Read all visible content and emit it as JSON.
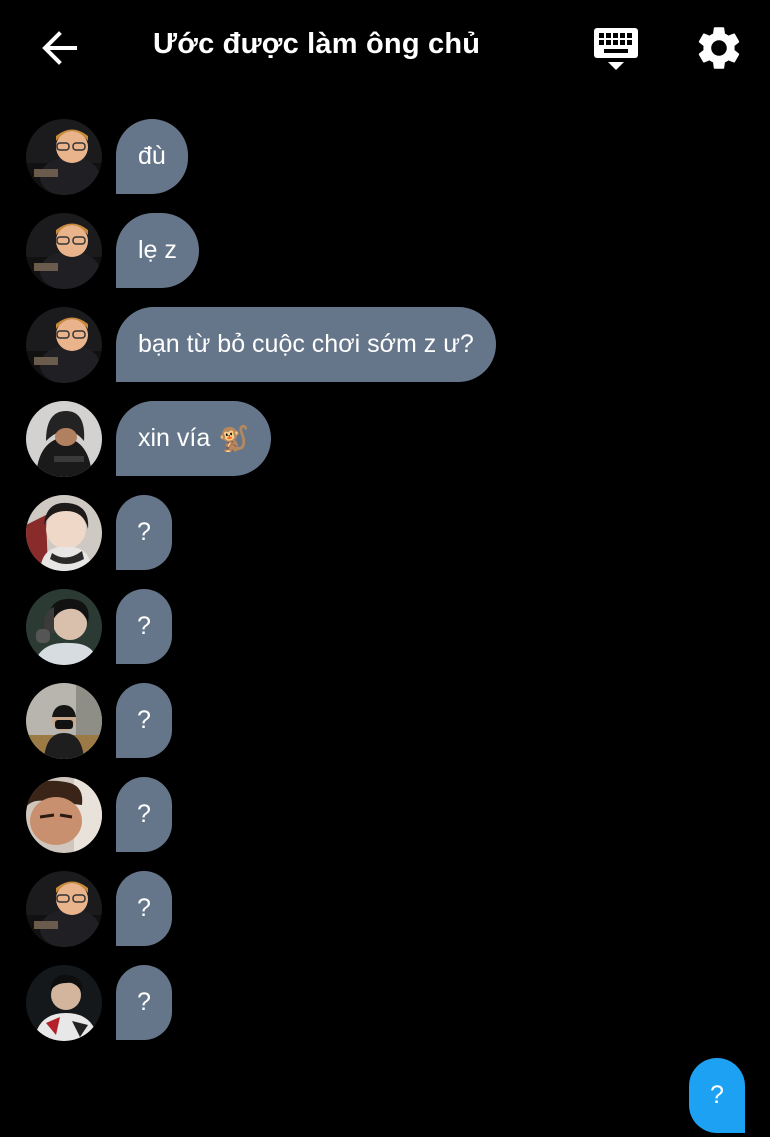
{
  "header": {
    "title": "Ước được làm ông chủ",
    "icons": {
      "back": "arrow-left-icon",
      "keyboard": "keyboard-icon",
      "settings": "gear-icon"
    }
  },
  "messages": [
    {
      "text": "đù",
      "avatar": "avatar-glasses-boy"
    },
    {
      "text": "lẹ z",
      "avatar": "avatar-glasses-boy"
    },
    {
      "text": "bạn từ bỏ cuộc chơi sớm z ư?",
      "avatar": "avatar-glasses-boy"
    },
    {
      "text": "xin vía",
      "emoji": "🐒",
      "avatar": "avatar-hooded"
    },
    {
      "text": "?",
      "avatar": "avatar-soft-face"
    },
    {
      "text": "?",
      "avatar": "avatar-headset"
    },
    {
      "text": "?",
      "avatar": "avatar-mask"
    },
    {
      "text": "?",
      "avatar": "avatar-closeup"
    },
    {
      "text": "?",
      "avatar": "avatar-glasses-boy"
    },
    {
      "text": "?",
      "avatar": "avatar-jersey"
    }
  ],
  "composer": {
    "outgoing_bubble": "?"
  },
  "colors": {
    "background": "#000000",
    "incoming_bubble": "#66768a",
    "outgoing_bubble": "#1da1f2",
    "text": "#ffffff"
  }
}
